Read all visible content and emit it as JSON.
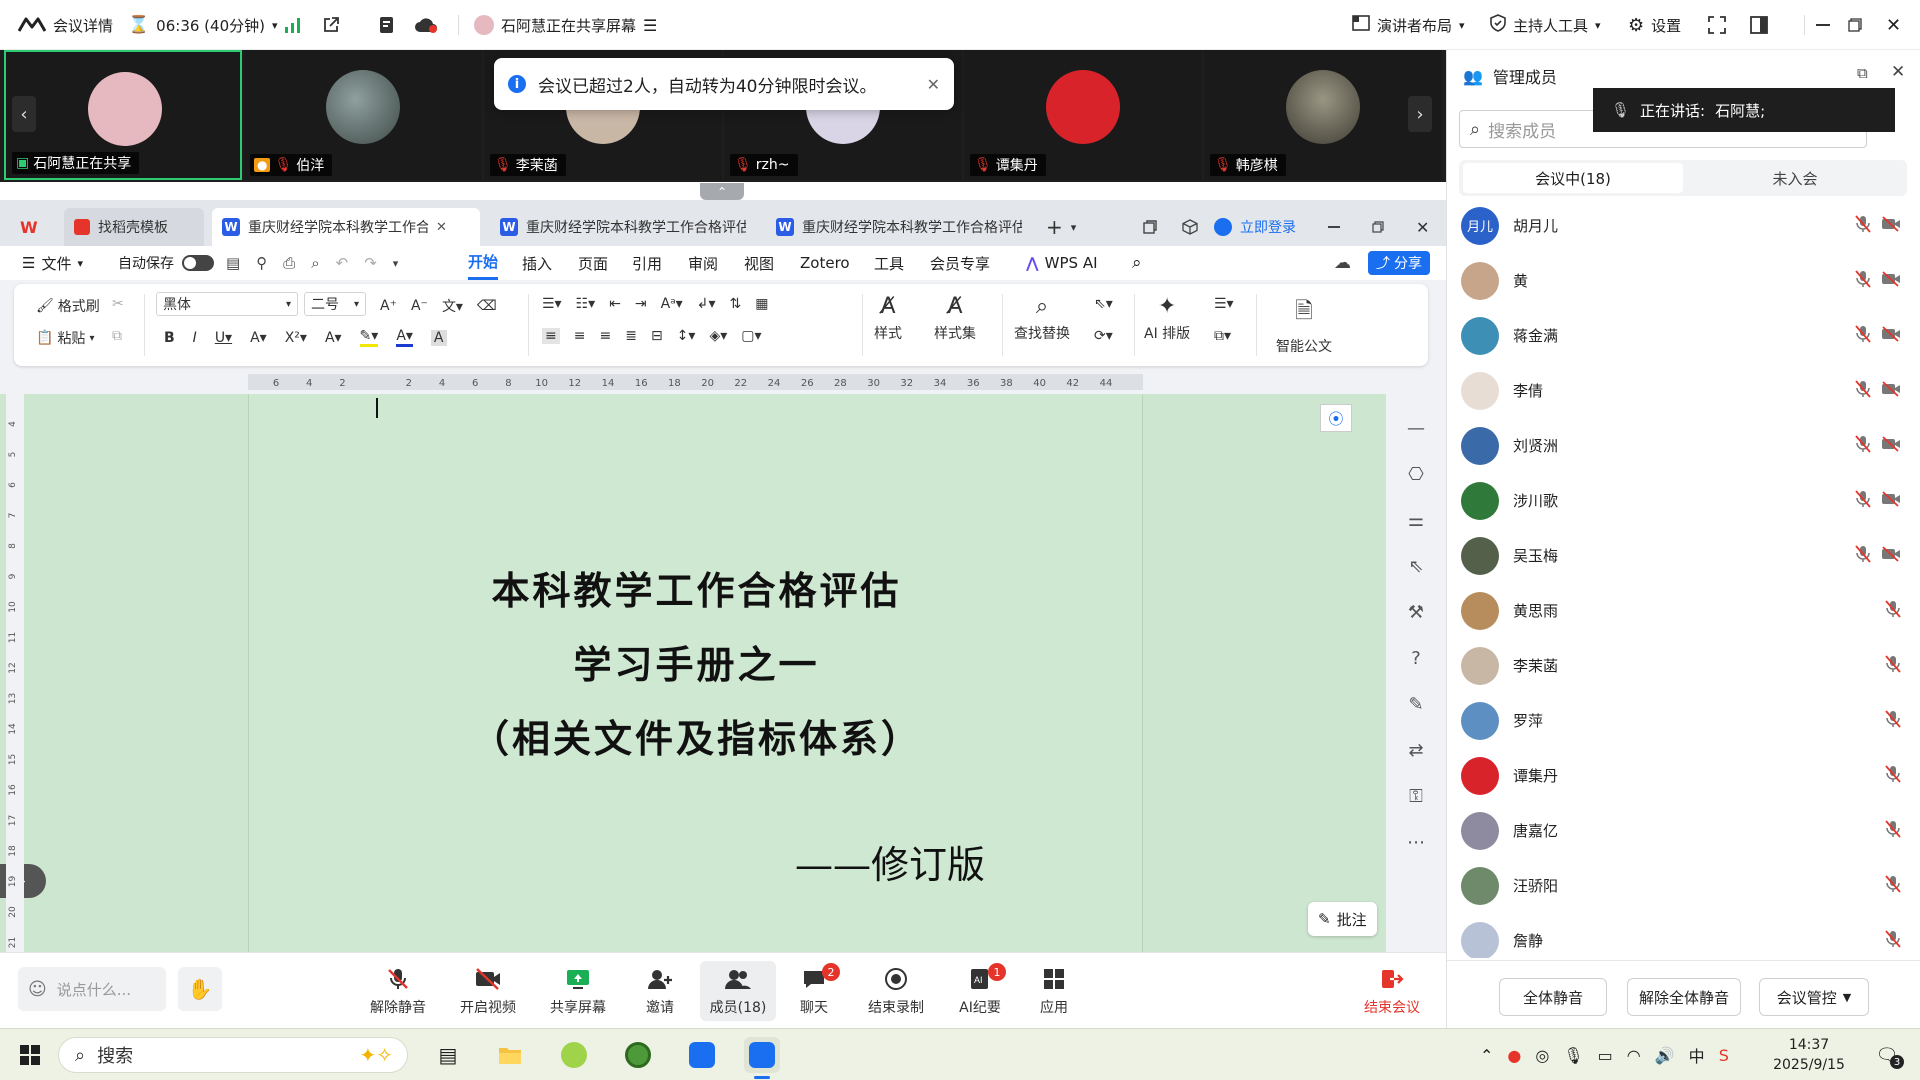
{
  "topbar": {
    "meeting_details": "会议详情",
    "timer": "06:36 (40分钟)",
    "sharing_status": "石阿慧正在共享屏幕",
    "presenter_layout": "演讲者布局",
    "host_tools": "主持人工具",
    "settings": "设置"
  },
  "video_strip": {
    "tiles": [
      {
        "name": "石阿慧正在共享",
        "color": "#e6b8c0"
      },
      {
        "name": "伯洋",
        "color": "#5c6b6a"
      },
      {
        "name": "李茉菡",
        "color": "#c9b7a6"
      },
      {
        "name": "rzh~",
        "color": "#d9d4e6"
      },
      {
        "name": "谭集丹",
        "color": "#d9232b"
      },
      {
        "name": "韩彦棋",
        "color": "#6d6a5f"
      }
    ]
  },
  "toast": {
    "text": "会议已超过2人，自动转为40分钟限时会议。"
  },
  "wps": {
    "tabs": [
      "找稻壳模板",
      "重庆财经学院本科教学工作合",
      "重庆财经学院本科教学工作合格评估",
      "重庆财经学院本科教学工作合格评估"
    ],
    "login": "立即登录",
    "menu": {
      "file": "文件",
      "autosave": "自动保存",
      "items": [
        "开始",
        "插入",
        "页面",
        "引用",
        "审阅",
        "视图",
        "Zotero",
        "工具",
        "会员专享"
      ],
      "wps_ai": "WPS AI",
      "share": "分享"
    },
    "ribbon": {
      "format_painter": "格式刷",
      "paste": "粘贴",
      "font": "黑体",
      "size": "二号",
      "styles": "样式",
      "style_set": "样式集",
      "find_replace": "查找替换",
      "ai_layout": "AI 排版",
      "smart_doc": "智能公文"
    },
    "ruler_h": [
      "6",
      "4",
      "2",
      "",
      "2",
      "4",
      "6",
      "8",
      "10",
      "12",
      "14",
      "16",
      "18",
      "20",
      "22",
      "24",
      "26",
      "28",
      "30",
      "32",
      "34",
      "36",
      "38",
      "40",
      "42",
      "44"
    ],
    "ruler_v": [
      "4",
      "5",
      "6",
      "7",
      "8",
      "9",
      "10",
      "11",
      "12",
      "13",
      "14",
      "15",
      "16",
      "17",
      "18",
      "19",
      "20",
      "21"
    ],
    "doc": {
      "line1": "本科教学工作合格评估",
      "line2": "学习手册之一",
      "line3": "（相关文件及指标体系）",
      "line4": "——修订版"
    },
    "annotate": "批注"
  },
  "bottombar": {
    "chat_placeholder": "说点什么...",
    "buttons": [
      {
        "label": "解除静音",
        "icon": "mic-off-icon"
      },
      {
        "label": "开启视频",
        "icon": "camera-off-icon"
      },
      {
        "label": "共享屏幕",
        "icon": "share-screen-icon"
      },
      {
        "label": "邀请",
        "icon": "invite-icon"
      },
      {
        "label": "成员(18)",
        "icon": "members-icon"
      },
      {
        "label": "聊天",
        "icon": "chat-icon",
        "badge": "2"
      },
      {
        "label": "结束录制",
        "icon": "record-icon"
      },
      {
        "label": "AI纪要",
        "icon": "ai-notes-icon",
        "badge": "1"
      },
      {
        "label": "应用",
        "icon": "apps-icon"
      }
    ],
    "end_meeting": "结束会议"
  },
  "panel": {
    "title": "管理成员",
    "speaking": "正在讲话:",
    "speaker": "石阿慧;",
    "search_placeholder": "搜索成员",
    "tab_in": "会议中(18)",
    "tab_out": "未入会",
    "members": [
      {
        "name": "胡月儿",
        "avatar_text": "月儿",
        "color": "#2b62c9",
        "cam": true
      },
      {
        "name": "黄",
        "color": "#c7a58a",
        "cam": true
      },
      {
        "name": "蒋金满",
        "color": "#3d8fb5",
        "cam": true
      },
      {
        "name": "李倩",
        "color": "#e8ddd4",
        "cam": true
      },
      {
        "name": "刘贤洲",
        "color": "#3a6aa8",
        "cam": true
      },
      {
        "name": "涉川歌",
        "color": "#2f7a3a",
        "cam": true
      },
      {
        "name": "吴玉梅",
        "color": "#54604a",
        "cam": true
      },
      {
        "name": "黄思雨",
        "color": "#b88d5d",
        "cam": false
      },
      {
        "name": "李茉菡",
        "color": "#c9b7a6",
        "cam": false
      },
      {
        "name": "罗萍",
        "color": "#5e8fc2",
        "cam": false
      },
      {
        "name": "谭集丹",
        "color": "#d9232b",
        "cam": false
      },
      {
        "name": "唐嘉亿",
        "color": "#8e8ba0",
        "cam": false
      },
      {
        "name": "汪骄阳",
        "color": "#6f8a6a",
        "cam": false
      },
      {
        "name": "詹静",
        "color": "#b8c2d6",
        "cam": false
      }
    ],
    "mute_all": "全体静音",
    "unmute_all": "解除全体静音",
    "meeting_control": "会议管控"
  },
  "taskbar": {
    "search": "搜索",
    "time": "14:37",
    "date": "2025/9/15",
    "notif_count": "3"
  }
}
